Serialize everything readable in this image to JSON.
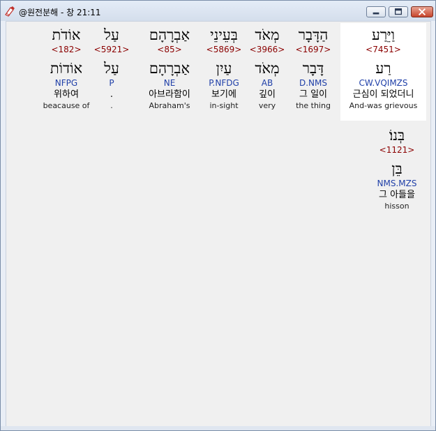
{
  "window": {
    "title": "@원전분해 - 창 21:11"
  },
  "words": [
    {
      "hebrew": "וַיֵּרַע",
      "strong": "<7451>",
      "lemma": "רַע",
      "morph": "CW.VQIMZS",
      "korean": "근심이 되었더니",
      "english": "And-was grievous",
      "selected": true
    },
    {
      "hebrew": "הַדָּבָר",
      "strong": "<1697>",
      "lemma": "דָּבָר",
      "morph": "D.NMS",
      "korean": "그 일이",
      "english": "the thing",
      "selected": false
    },
    {
      "hebrew": "מְאֹד",
      "strong": "<3966>",
      "lemma": "מְאֹד",
      "morph": "AB",
      "korean": "깊이",
      "english": "very",
      "selected": false
    },
    {
      "hebrew": "בְּעֵינֵי",
      "strong": "<5869>",
      "lemma": "עַיִן",
      "morph": "P.NFDG",
      "korean": "보기에",
      "english": "in-sight",
      "selected": false
    },
    {
      "hebrew": "אַבְרָהָם",
      "strong": "<85>",
      "lemma": "אַבְרָהָם",
      "morph": "NE",
      "korean": "아브라함이",
      "english": "Abraham's",
      "selected": false
    },
    {
      "hebrew": "עַל",
      "strong": "<5921>",
      "lemma": "עַל",
      "morph": "P",
      "korean": ".",
      "english": ".",
      "selected": false
    },
    {
      "hebrew": "אוֹדֹת",
      "strong": "<182>",
      "lemma": "אוֹדוֹת",
      "morph": "NFPG",
      "korean": "위하여",
      "english": "beacause of",
      "selected": false
    },
    {
      "hebrew": "בְּנוֹ׃",
      "strong": "<1121>",
      "lemma": "בֵּן",
      "morph": "NMS.MZS",
      "korean": "그 아들을",
      "english": "hisson",
      "selected": false
    }
  ],
  "colors": {
    "strong": "#8b0000",
    "morph": "#1f3fa8",
    "selected_bg": "#ffffff"
  }
}
